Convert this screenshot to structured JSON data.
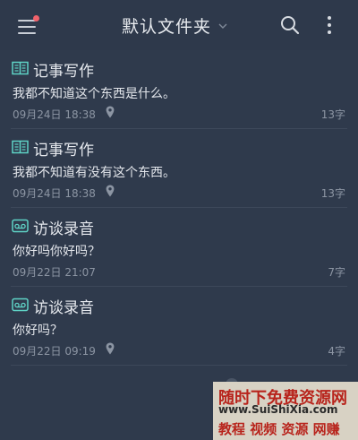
{
  "header": {
    "folder_name": "默认文件夹",
    "menu_icon": "hamburger-menu-icon",
    "search_icon": "search-icon",
    "more_icon": "more-vertical-icon",
    "notification_color": "#f0626b"
  },
  "notes": [
    {
      "type_icon": "book-icon",
      "type_label": "记事写作",
      "content": "我都不知道这个东西是什么。",
      "date": "09月24日 18:38",
      "count": "13字"
    },
    {
      "type_icon": "book-icon",
      "type_label": "记事写作",
      "content": "我都不知道有没有这个东西。",
      "date": "09月24日 18:38",
      "count": "13字"
    },
    {
      "type_icon": "voicemail-icon",
      "type_label": "访谈录音",
      "content": "你好吗你好吗？",
      "date": "09月22日 21:07",
      "count": "7字"
    },
    {
      "type_icon": "voicemail-icon",
      "type_label": "访谈录音",
      "content": "你好吗？",
      "date": "09月22日 09:19",
      "count": "4字"
    }
  ],
  "watermark": {
    "line1": "随时下免费资源网",
    "line2": "www.SuiShiXia.com",
    "line3": "教程 视频 资源 网赚"
  },
  "colors": {
    "background": "#2f3a4c",
    "accent_icon": "#5fd3c6",
    "text_primary": "#e6e9ee",
    "text_secondary": "#8c95a3"
  }
}
